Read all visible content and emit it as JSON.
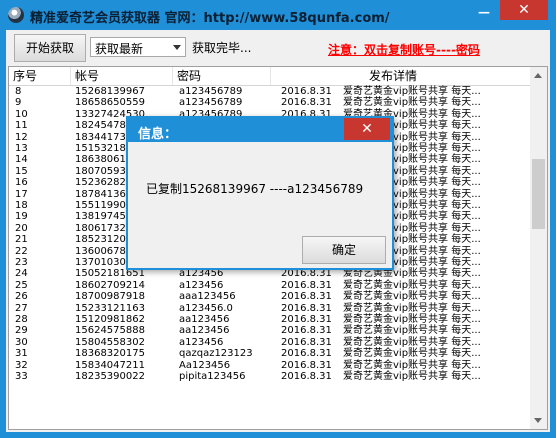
{
  "window": {
    "title": "精准爱奇艺会员获取器 官网：http://www.58qunfa.com/",
    "minimize_symbol": "—",
    "close_symbol": "✕"
  },
  "toolbar": {
    "start_label": "开始获取",
    "mode_selected": "获取最新",
    "status_text": "获取完毕...",
    "notice": "注意：双击复制账号----密码"
  },
  "table": {
    "headers": [
      "序号",
      "帐号",
      "密码",
      "发布详情"
    ],
    "rows": [
      [
        "8",
        "15268139967",
        "a123456789",
        "2016.8.31",
        "爱奇艺黄金vip账号共享 每天..."
      ],
      [
        "9",
        "18658650559",
        "a123456789",
        "2016.8.31",
        "爱奇艺黄金vip账号共享 每天..."
      ],
      [
        "10",
        "13327424530",
        "a123456789",
        "2016.8.31",
        "爱奇艺黄金vip账号共享 每天..."
      ],
      [
        "11",
        "18245478012",
        "",
        "2016.8.31",
        "爱奇艺黄金vip账号共享 每天..."
      ],
      [
        "12",
        "18344173100",
        "",
        "2016.8.31",
        "爱奇艺黄金vip账号共享 每天..."
      ],
      [
        "13",
        "15153218900",
        "",
        "2016.8.31",
        "爱奇艺黄金vip账号共享 每天..."
      ],
      [
        "14",
        "18638061000",
        "",
        "2016.8.31",
        "爱奇艺黄金vip账号共享 每天..."
      ],
      [
        "15",
        "18070593200",
        "",
        "2016.8.31",
        "爱奇艺黄金vip账号共享 每天..."
      ],
      [
        "16",
        "15236282100",
        "",
        "2016.8.31",
        "爱奇艺黄金vip账号共享 每天..."
      ],
      [
        "17",
        "18784136000",
        "",
        "2016.8.31",
        "爱奇艺黄金vip账号共享 每天..."
      ],
      [
        "18",
        "15511990700",
        "",
        "2016.8.31",
        "爱奇艺黄金vip账号共享 每天..."
      ],
      [
        "19",
        "13819745900",
        "",
        "2016.8.31",
        "爱奇艺黄金vip账号共享 每天..."
      ],
      [
        "20",
        "18061732000",
        "",
        "2016.8.31",
        "爱奇艺黄金vip账号共享 每天..."
      ],
      [
        "21",
        "18523120600",
        "",
        "2016.8.31",
        "爱奇艺黄金vip账号共享 每天..."
      ],
      [
        "22",
        "13600678000",
        "",
        "2016.8.31",
        "爱奇艺黄金vip账号共享 每天..."
      ],
      [
        "23",
        "13701030313",
        "aaa123456",
        "2016.8.31",
        "爱奇艺黄金vip账号共享 每天..."
      ],
      [
        "24",
        "15052181651",
        "a123456",
        "2016.8.31",
        "爱奇艺黄金vip账号共享 每天..."
      ],
      [
        "25",
        "18602709214",
        "a123456",
        "2016.8.31",
        "爱奇艺黄金vip账号共享 每天..."
      ],
      [
        "26",
        "18700987918",
        "aaa123456",
        "2016.8.31",
        "爱奇艺黄金vip账号共享 每天..."
      ],
      [
        "27",
        "15233121163",
        "a123456.0",
        "2016.8.31",
        "爱奇艺黄金vip账号共享 每天..."
      ],
      [
        "28",
        "15120981862",
        "aa123456",
        "2016.8.31",
        "爱奇艺黄金vip账号共享 每天..."
      ],
      [
        "29",
        "15624575888",
        "aa123456",
        "2016.8.31",
        "爱奇艺黄金vip账号共享 每天..."
      ],
      [
        "30",
        "15804558302",
        "a123456",
        "2016.8.31",
        "爱奇艺黄金vip账号共享 每天..."
      ],
      [
        "31",
        "18368320175",
        "qazqaz123123",
        "2016.8.31",
        "爱奇艺黄金vip账号共享 每天..."
      ],
      [
        "32",
        "15834047211",
        "Aa123456",
        "2016.8.31",
        "爱奇艺黄金vip账号共享 每天..."
      ],
      [
        "33",
        "18235390022",
        "pipita123456",
        "2016.8.31",
        "爱奇艺黄金vip账号共享 每天..."
      ]
    ]
  },
  "dialog": {
    "title": "信息：",
    "message": "已复制15268139967 ----a123456789",
    "ok_label": "确定",
    "close_symbol": "✕"
  }
}
